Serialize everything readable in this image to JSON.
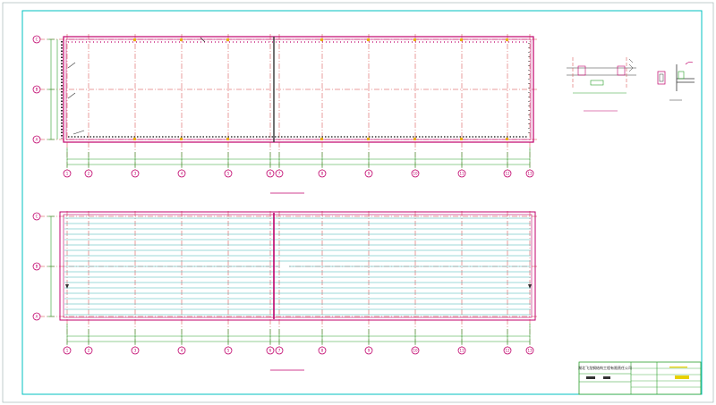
{
  "sheet": {
    "title_block": {
      "company": "湖北飞龙钢结构工程有限责任公司",
      "rows": [
        "",
        "",
        "",
        "",
        ""
      ]
    }
  },
  "plan_top": {
    "title": "",
    "scale": "",
    "subtitle": "",
    "grid_bottom": [
      "1",
      "2",
      "3",
      "4",
      "5",
      "6",
      "7",
      "8",
      "9",
      "10",
      "11",
      "12",
      "13"
    ],
    "grid_left": [
      "C",
      "B",
      "A"
    ],
    "dims_bottom": [
      "",
      "",
      "",
      "",
      "",
      "",
      "",
      "",
      "",
      "",
      ""
    ],
    "dim_total": ""
  },
  "plan_bottom": {
    "title": "",
    "scale": "",
    "grid_bottom": [
      "1",
      "2",
      "3",
      "4",
      "5",
      "6",
      "7",
      "8",
      "9",
      "10",
      "11",
      "12",
      "13"
    ],
    "grid_left": [
      "C",
      "B",
      "A"
    ],
    "dims_bottom": [
      "",
      "",
      "",
      "",
      "",
      "",
      "",
      "",
      "",
      "",
      ""
    ],
    "dim_total": ""
  },
  "details": {
    "detail_a_title": "",
    "detail_a_note": "",
    "detail_b_label": ""
  },
  "colors": {
    "frame": "#00c0c0",
    "wall": "#c0006b",
    "grid": "#d23c3c",
    "dim": "#2aa02a",
    "hatch": "#3bb5b5",
    "text": "#202020"
  }
}
